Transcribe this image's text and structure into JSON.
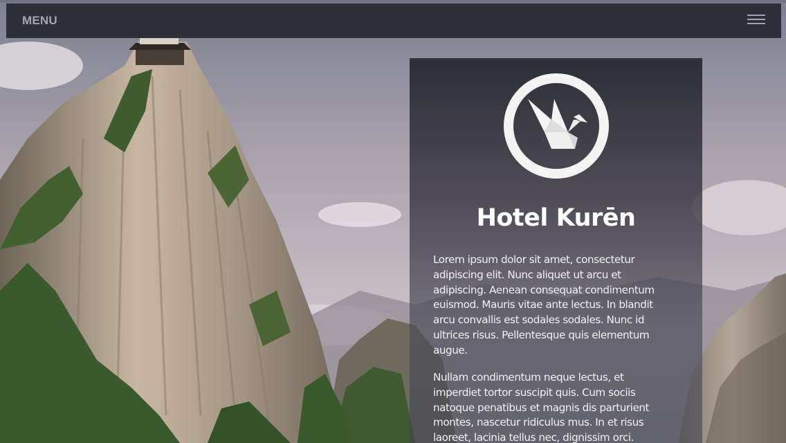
{
  "menu": {
    "label": "MENU",
    "toggle_icon": "hamburger-icon"
  },
  "hero": {
    "background": "mountain-cliff-with-pagoda"
  },
  "card": {
    "logo_icon": "origami-crane-icon",
    "title": "Hotel Kurēn",
    "paragraphs": [
      "Lorem ipsum dolor sit amet, consectetur adipiscing elit. Nunc aliquet ut arcu et adipiscing. Aenean consequat condimentum euismod. Mauris vitae ante lectus. In blandit arcu convallis est sodales sodales. Nunc id ultrices risus. Pellentesque quis elementum augue.",
      "Nullam condimentum neque lectus, et imperdiet tortor suscipit quis. Cum sociis natoque penatibus et magnis dis parturient montes, nascetur ridiculus mus. In et risus laoreet, lacinia tellus nec, dignissim orci."
    ]
  },
  "colors": {
    "menu_bar": "#2c2f38",
    "menu_text": "#a3a6ae",
    "card_overlay": "#262830",
    "title_text": "#ffffff"
  }
}
